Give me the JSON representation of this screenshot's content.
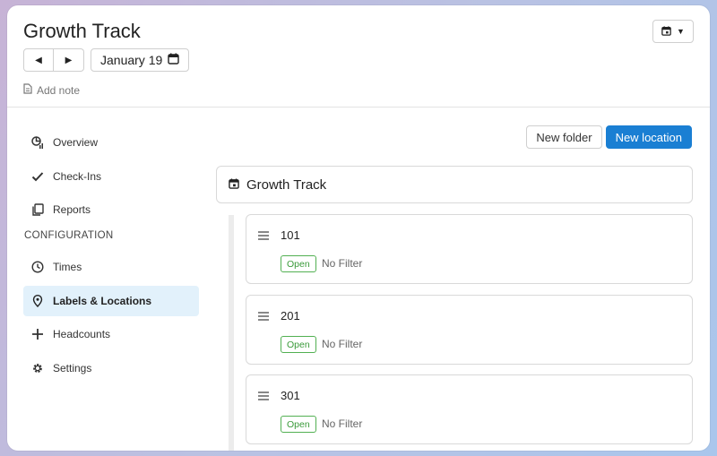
{
  "header": {
    "title": "Growth Track",
    "date_label": "January 19",
    "add_note_label": "Add note"
  },
  "sidebar": {
    "items_top": [
      {
        "label": "Overview",
        "icon": "overview-chart-icon"
      },
      {
        "label": "Check-Ins",
        "icon": "check-icon"
      },
      {
        "label": "Reports",
        "icon": "reports-icon"
      }
    ],
    "section_heading": "CONFIGURATION",
    "items_config": [
      {
        "label": "Times",
        "icon": "clock-icon"
      },
      {
        "label": "Labels & Locations",
        "icon": "location-pin-icon",
        "active": true
      },
      {
        "label": "Headcounts",
        "icon": "plus-icon"
      },
      {
        "label": "Settings",
        "icon": "gear-icon"
      }
    ]
  },
  "toolbar": {
    "new_folder_label": "New folder",
    "new_location_label": "New location"
  },
  "folder": {
    "name": "Growth Track"
  },
  "locations": [
    {
      "name": "101",
      "status": "Open",
      "filter": "No Filter"
    },
    {
      "name": "201",
      "status": "Open",
      "filter": "No Filter"
    },
    {
      "name": "301",
      "status": "Open",
      "filter": "No Filter"
    }
  ],
  "colors": {
    "accent": "#1a7fd3",
    "active_bg": "#e2f1fb",
    "status_open": "#3a9a3a"
  }
}
